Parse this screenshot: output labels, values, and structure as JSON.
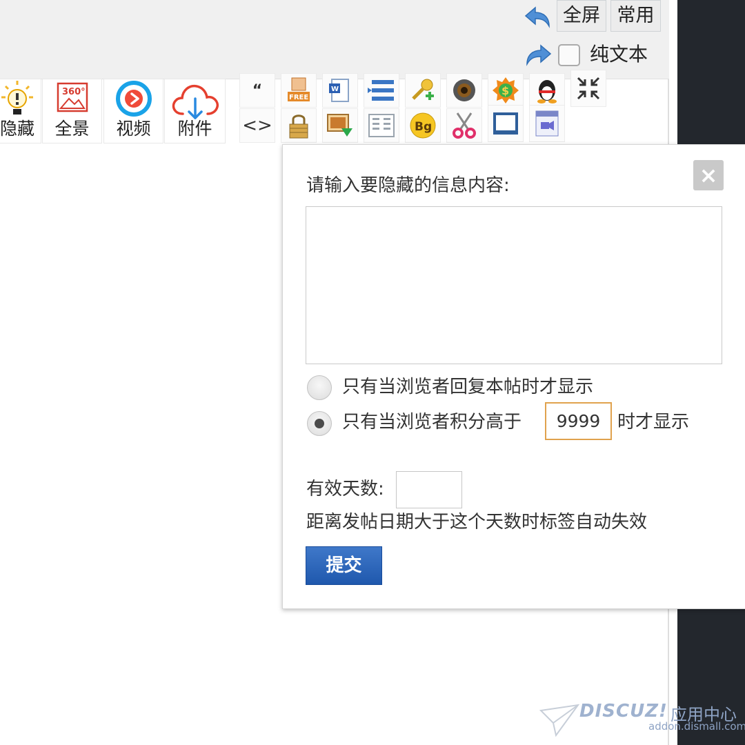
{
  "toolbar_top": {
    "fullscreen_label": "全屏",
    "common_label": "常用",
    "plain_text_label": "纯文本"
  },
  "tools_big": [
    {
      "icon": "bulb-icon",
      "label": "隐藏"
    },
    {
      "icon": "panorama-360-icon",
      "label": "全景"
    },
    {
      "icon": "video-play-icon",
      "label": "视频"
    },
    {
      "icon": "cloud-download-icon",
      "label": "附件"
    }
  ],
  "tools_small_row1": [
    "quote-icon",
    "free-tag-icon",
    "word-doc-icon",
    "list-icon",
    "key-add-icon",
    "camera-icon",
    "coin-icon",
    "qq-penguin-icon",
    "shrink-icon"
  ],
  "tools_small_row2": [
    "code-icon",
    "lock-icon",
    "image-insert-icon",
    "columns-icon",
    "bg-color-icon",
    "scissors-icon",
    "frame-icon",
    "media-icon"
  ],
  "popup": {
    "title": "请输入要隐藏的信息内容:",
    "textarea_value": "",
    "option_reply": "只有当浏览者回复本帖时才显示",
    "option_score_prefix": "只有当浏览者积分高于",
    "score_value": "9999",
    "option_score_suffix": "时才显示",
    "selected_option": "score",
    "days_label": "有效天数:",
    "days_value": "",
    "days_hint": "距离发帖日期大于这个天数时标签自动失效",
    "submit_label": "提交",
    "close_symbol": "×"
  },
  "watermark": {
    "brand": "DISCUZ!",
    "cn": "应用中心",
    "url": "addon.dismall.com"
  },
  "colors": {
    "accent_blue": "#1f58ad",
    "score_border": "#e0a24d",
    "sidebar_dark": "#23272d"
  }
}
